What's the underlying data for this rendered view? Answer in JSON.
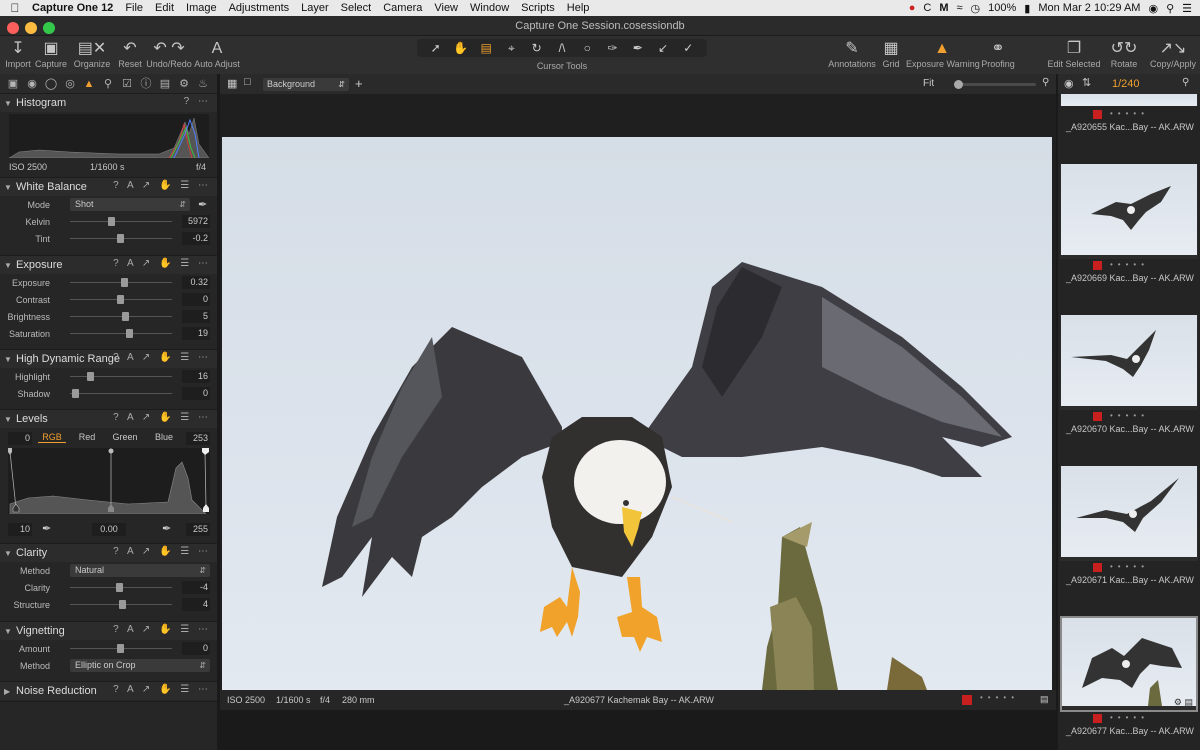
{
  "menubar": {
    "items": [
      "Capture One 12",
      "File",
      "Edit",
      "Image",
      "Adjustments",
      "Layer",
      "Select",
      "Camera",
      "View",
      "Window",
      "Scripts",
      "Help"
    ],
    "battery": "100%",
    "clock": "Mon Mar 2  10:29 AM"
  },
  "window": {
    "title": "Capture One Session.cosessiondb"
  },
  "toolbar": {
    "left": [
      {
        "label": "Import",
        "icon": "import-icon"
      },
      {
        "label": "Capture",
        "icon": "camera-icon"
      },
      {
        "label": "Organize",
        "icon": "organize-icon"
      },
      {
        "label": "Reset",
        "icon": "reset-icon"
      },
      {
        "label": "Undo/Redo",
        "icon": "undo-redo-icon"
      },
      {
        "label": "Auto Adjust",
        "icon": "auto-adjust-icon"
      }
    ],
    "cursor_tools_label": "Cursor Tools",
    "right": [
      {
        "label": "Annotations",
        "icon": "annotations-icon"
      },
      {
        "label": "Grid",
        "icon": "grid-icon"
      },
      {
        "label": "Exposure Warning",
        "icon": "warning-icon"
      },
      {
        "label": "Proofing",
        "icon": "glasses-icon"
      },
      {
        "label": "Edit Selected",
        "icon": "edit-selected-icon"
      },
      {
        "label": "Rotate",
        "icon": "rotate-icon"
      },
      {
        "label": "Copy/Apply",
        "icon": "copy-apply-icon"
      }
    ]
  },
  "viewer_bar": {
    "background": "Background",
    "zoom": "Fit"
  },
  "browser": {
    "count": "1/240"
  },
  "histogram": {
    "title": "Histogram",
    "iso": "ISO 2500",
    "shutter": "1/1600 s",
    "aperture": "f/4"
  },
  "white_balance": {
    "title": "White Balance",
    "mode_label": "Mode",
    "mode_value": "Shot",
    "kelvin_label": "Kelvin",
    "kelvin": "5972",
    "tint_label": "Tint",
    "tint": "-0.2"
  },
  "exposure": {
    "title": "Exposure",
    "rows": [
      {
        "label": "Exposure",
        "value": "0.32"
      },
      {
        "label": "Contrast",
        "value": "0"
      },
      {
        "label": "Brightness",
        "value": "5"
      },
      {
        "label": "Saturation",
        "value": "19"
      }
    ]
  },
  "hdr": {
    "title": "High Dynamic Range",
    "rows": [
      {
        "label": "Highlight",
        "value": "16"
      },
      {
        "label": "Shadow",
        "value": "0"
      }
    ]
  },
  "levels": {
    "title": "Levels",
    "low_out": "0",
    "high_out": "253",
    "tabs": [
      "RGB",
      "Red",
      "Green",
      "Blue"
    ],
    "low_in": "10",
    "mid": "0.00",
    "high_in": "255"
  },
  "clarity": {
    "title": "Clarity",
    "method_label": "Method",
    "method": "Natural",
    "rows": [
      {
        "label": "Clarity",
        "value": "-4"
      },
      {
        "label": "Structure",
        "value": "4"
      }
    ]
  },
  "vignetting": {
    "title": "Vignetting",
    "amount_label": "Amount",
    "amount": "0",
    "method_label": "Method",
    "method": "Elliptic on Crop"
  },
  "noise": {
    "title": "Noise Reduction"
  },
  "footer": {
    "iso": "ISO 2500",
    "shutter": "1/1600 s",
    "aperture": "f/4",
    "focal": "280 mm",
    "filename": "_A920677 Kachemak Bay -- AK.ARW"
  },
  "thumbs": [
    "_A920655 Kac...Bay -- AK.ARW",
    "_A920669 Kac...Bay -- AK.ARW",
    "_A920670 Kac...Bay -- AK.ARW",
    "_A920671 Kac...Bay -- AK.ARW",
    "_A920677 Kac...Bay -- AK.ARW"
  ],
  "colors": {
    "accent": "#f0a030",
    "flag_red": "#c8201f",
    "panel": "#262626"
  }
}
